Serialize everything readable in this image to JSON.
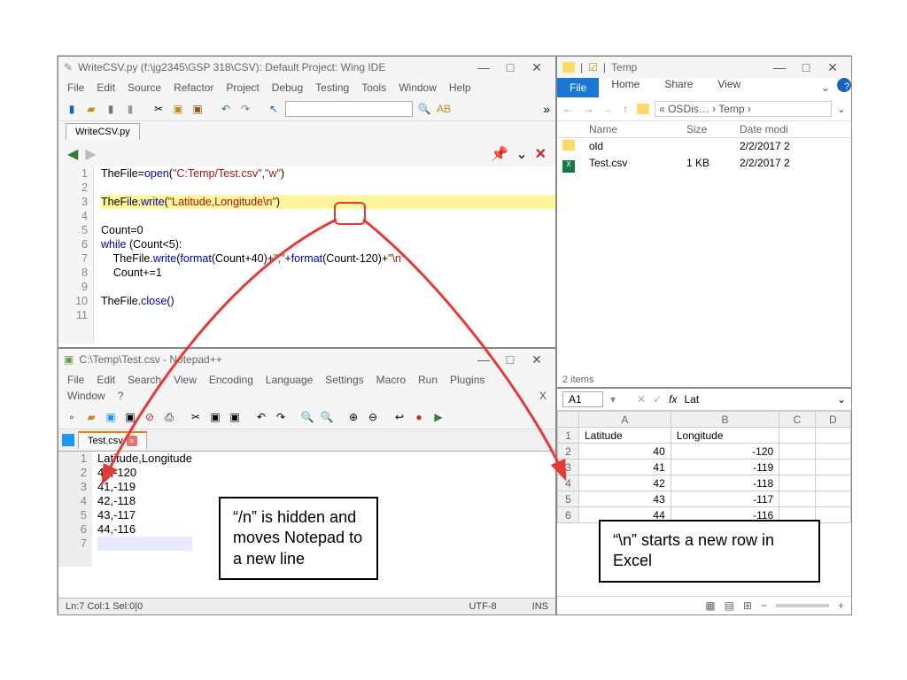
{
  "ide": {
    "title": "WriteCSV.py (f:\\jg2345\\GSP 318\\CSV): Default Project: Wing IDE",
    "menu": [
      "File",
      "Edit",
      "Source",
      "Refactor",
      "Project",
      "Debug",
      "Testing",
      "Tools",
      "Window",
      "Help"
    ],
    "tab": "WriteCSV.py",
    "lines": [
      "TheFile=open(\"C:Temp/Test.csv\",\"w\")",
      "",
      "TheFile.write(\"Latitude,Longitude\\n\")",
      "",
      "Count=0",
      "while (Count<5):",
      "    TheFile.write(format(Count+40)+\",\"+format(Count-120)+\"\\n\"",
      "    Count+=1",
      "",
      "TheFile.close()",
      ""
    ]
  },
  "explorer": {
    "title": "Temp",
    "ribbon_file": "File",
    "ribbon": [
      "Home",
      "Share",
      "View"
    ],
    "breadcrumb": "« OSDis… › Temp ›",
    "columns": [
      "Name",
      "Size",
      "Date modi"
    ],
    "rows": [
      {
        "icon": "folder",
        "name": "old",
        "size": "",
        "date": "2/2/2017 2"
      },
      {
        "icon": "xls",
        "name": "Test.csv",
        "size": "1 KB",
        "date": "2/2/2017 2"
      }
    ],
    "footer": "2 items"
  },
  "npp": {
    "title": "C:\\Temp\\Test.csv - Notepad++",
    "menu1": [
      "File",
      "Edit",
      "Search",
      "View",
      "Encoding",
      "Language",
      "Settings",
      "Macro",
      "Run",
      "Plugins"
    ],
    "menu2": [
      "Window",
      "?"
    ],
    "tab": "Test.csv",
    "lines": [
      "Latitude,Longitude",
      "40,-120",
      "41,-119",
      "42,-118",
      "43,-117",
      "44,-116",
      ""
    ],
    "status": {
      "pos": "Ln:7  Col:1  Sel:0|0",
      "enc": "UTF-8",
      "mode": "INS"
    }
  },
  "excel": {
    "active_cell": "A1",
    "formula": "Lat",
    "cols": [
      "A",
      "B",
      "C",
      "D"
    ],
    "rows": [
      [
        "Latitude",
        "Longitude",
        "",
        ""
      ],
      [
        "40",
        "-120",
        "",
        ""
      ],
      [
        "41",
        "-119",
        "",
        ""
      ],
      [
        "42",
        "-118",
        "",
        ""
      ],
      [
        "43",
        "-117",
        "",
        ""
      ],
      [
        "44",
        "-116",
        "",
        ""
      ]
    ]
  },
  "notes": {
    "left": "“/n” is hidden and moves Notepad to a new line",
    "right": "“\\n” starts a new row in Excel"
  }
}
